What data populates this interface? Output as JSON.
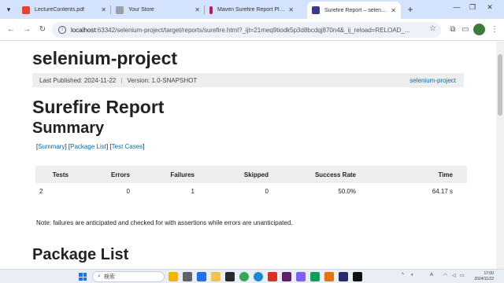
{
  "browser": {
    "tabs": [
      {
        "title": "LectureContents.pdf",
        "color": "#e94235"
      },
      {
        "title": "Your Store",
        "color": "#9aa0a6"
      },
      {
        "title": "Maven Surefire Report Plugin",
        "color": "#c2185b"
      },
      {
        "title": "Surefire Report – selenium-p",
        "color": "#3a3a8c"
      }
    ],
    "new_tab": "+",
    "url_host": "localhost",
    "url_rest": ":63342/selenium-project/target/reports/surefire.html?_ijt=21meq9tiodk5p3d8bcdqj870n4&_ij_reload=RELOAD_...",
    "nav": {
      "back": "←",
      "forward": "→",
      "reload": "↻"
    }
  },
  "page": {
    "project_title": "selenium-project",
    "banner": {
      "published": "Last Published: 2024-11-22",
      "divider": "|",
      "version": "Version: 1.0-SNAPSHOT",
      "project_link": "selenium-project"
    },
    "report_title": "Surefire Report",
    "summary_heading": "Summary",
    "section_links": {
      "open1": "[",
      "summary": "Summary",
      "mid1": "] [",
      "package_list": "Package List",
      "mid2": "] [",
      "test_cases": "Test Cases",
      "close": "]"
    },
    "summary_table": {
      "headers": [
        "Tests",
        "Errors",
        "Failures",
        "Skipped",
        "Success Rate",
        "Time"
      ],
      "rows": [
        [
          "2",
          "0",
          "1",
          "0",
          "50.0%",
          "64.17 s"
        ]
      ]
    },
    "note": "Note: failures are anticipated and checked for with assertions while errors are unanticipated.",
    "package_list_heading": "Package List"
  },
  "taskbar": {
    "search_placeholder": "検索",
    "time": "17:00",
    "date": "2024/11/22"
  }
}
